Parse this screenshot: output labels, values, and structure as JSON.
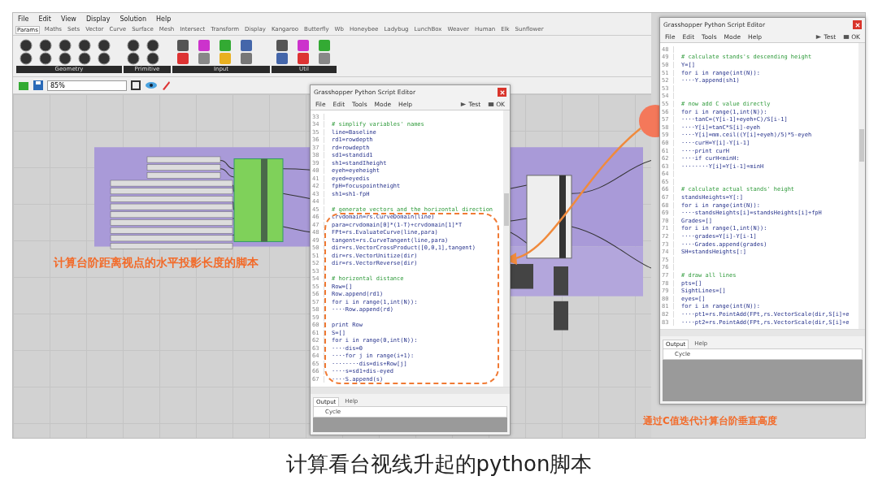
{
  "main_window": {
    "menu": [
      "File",
      "Edit",
      "View",
      "Display",
      "Solution",
      "Help"
    ],
    "tabs": [
      {
        "label": "Params",
        "selected": true
      },
      {
        "label": "Maths",
        "selected": false
      },
      {
        "label": "Sets",
        "selected": false
      },
      {
        "label": "Vector",
        "selected": false
      },
      {
        "label": "Curve",
        "selected": false
      },
      {
        "label": "Surface",
        "selected": false
      },
      {
        "label": "Mesh",
        "selected": false
      },
      {
        "label": "Intersect",
        "selected": false
      },
      {
        "label": "Transform",
        "selected": false
      },
      {
        "label": "Display",
        "selected": false
      },
      {
        "label": "Kangaroo",
        "selected": false
      },
      {
        "label": "Butterfly",
        "selected": false
      },
      {
        "label": "Wb",
        "selected": false
      },
      {
        "label": "Honeybee",
        "selected": false
      },
      {
        "label": "Ladybug",
        "selected": false
      },
      {
        "label": "LunchBox",
        "selected": false
      },
      {
        "label": "Weaver",
        "selected": false
      },
      {
        "label": "Human",
        "selected": false
      },
      {
        "label": "Elk",
        "selected": false
      },
      {
        "label": "Sunflower",
        "selected": false
      }
    ],
    "toolbar_groups": [
      "Geometry",
      "Primitive",
      "Input",
      "Util"
    ],
    "zoom": "85%"
  },
  "editors": [
    {
      "title": "Grasshopper Python Script Editor",
      "menu": [
        "File",
        "Edit",
        "Tools",
        "Mode",
        "Help"
      ],
      "test": "Test",
      "ok": "OK",
      "output_tabs": [
        {
          "label": "Output",
          "selected": true
        },
        {
          "label": "Help",
          "selected": false
        }
      ],
      "column": "Cycle",
      "lines": [
        {
          "n": "33",
          "kind": "blank"
        },
        {
          "n": "34",
          "text": "# simplify variables' names",
          "kind": "comment"
        },
        {
          "n": "35",
          "text": "line=Baseline",
          "kind": "code"
        },
        {
          "n": "36",
          "text": "rd1=rowdepth",
          "kind": "code"
        },
        {
          "n": "37",
          "text": "rd=rowdepth",
          "kind": "code"
        },
        {
          "n": "38",
          "text": "sd1=standid1",
          "kind": "code"
        },
        {
          "n": "39",
          "text": "sh1=standIheight",
          "kind": "code"
        },
        {
          "n": "40",
          "text": "eyeh=eyeheight",
          "kind": "code"
        },
        {
          "n": "41",
          "text": "eyed=eyedis",
          "kind": "code"
        },
        {
          "n": "42",
          "text": "fpH=focuspointheight",
          "kind": "code"
        },
        {
          "n": "43",
          "text": "sh1=sh1-fpH",
          "kind": "code"
        },
        {
          "n": "44",
          "kind": "blank"
        },
        {
          "n": "45",
          "text": "# generate vectors and the horizontal direction",
          "kind": "comment"
        },
        {
          "n": "46",
          "text": "crvdomain=rs.CurveDomain(line)",
          "kind": "code"
        },
        {
          "n": "47",
          "text": "para=crvdomain[0]*(1-T)+crvdomain[1]*T",
          "kind": "code"
        },
        {
          "n": "48",
          "text": "FPt=rs.EvaluateCurve(line,para)",
          "kind": "code"
        },
        {
          "n": "49",
          "text": "tangent=rs.CurveTangent(line,para)",
          "kind": "code"
        },
        {
          "n": "50",
          "text": "dir=rs.VectorCrossProduct([0,0,1],tangent)",
          "kind": "code"
        },
        {
          "n": "51",
          "text": "dir=rs.VectorUnitize(dir)",
          "kind": "code"
        },
        {
          "n": "52",
          "text": "dir=rs.VectorReverse(dir)",
          "kind": "code"
        },
        {
          "n": "53",
          "kind": "blank"
        },
        {
          "n": "54",
          "text": "# horizontal distance",
          "kind": "comment"
        },
        {
          "n": "55",
          "text": "Row=[]",
          "kind": "code"
        },
        {
          "n": "56",
          "text": "Row.append(rd1)",
          "kind": "code"
        },
        {
          "n": "57",
          "text": "for i in range(1,int(N)):",
          "kind": "code"
        },
        {
          "n": "58",
          "text": "····Row.append(rd)",
          "kind": "code"
        },
        {
          "n": "59",
          "kind": "blank"
        },
        {
          "n": "60",
          "text": "print Row",
          "kind": "code"
        },
        {
          "n": "61",
          "text": "S=[]",
          "kind": "code"
        },
        {
          "n": "62",
          "text": "for i in range(0,int(N)):",
          "kind": "code"
        },
        {
          "n": "63",
          "text": "····dis=0",
          "kind": "code"
        },
        {
          "n": "64",
          "text": "····for j in range(i+1):",
          "kind": "code"
        },
        {
          "n": "65",
          "text": "········dis=dis+Row[j]",
          "kind": "code"
        },
        {
          "n": "66",
          "text": "····s=sd1+dis-eyed",
          "kind": "code"
        },
        {
          "n": "67",
          "text": "····S.append(s)",
          "kind": "code"
        }
      ]
    },
    {
      "title": "Grasshopper Python Script Editor",
      "menu": [
        "File",
        "Edit",
        "Tools",
        "Mode",
        "Help"
      ],
      "test": "Test",
      "ok": "OK",
      "output_tabs": [
        {
          "label": "Output",
          "selected": true
        },
        {
          "label": "Help",
          "selected": false
        }
      ],
      "column": "Cycle",
      "lines": [
        {
          "n": "48",
          "kind": "blank"
        },
        {
          "n": "49",
          "text": "# calculate stands's descending height",
          "kind": "comment"
        },
        {
          "n": "50",
          "text": "Y=[]",
          "kind": "code"
        },
        {
          "n": "51",
          "text": "for i in range(int(N)):",
          "kind": "code"
        },
        {
          "n": "52",
          "text": "····Y.append(sh1)",
          "kind": "code"
        },
        {
          "n": "53",
          "kind": "blank"
        },
        {
          "n": "54",
          "kind": "blank"
        },
        {
          "n": "55",
          "text": "# now add C value directly",
          "kind": "comment"
        },
        {
          "n": "56",
          "text": "for i in range(1,int(N)):",
          "kind": "code"
        },
        {
          "n": "57",
          "text": "····tanC=(Y[i-1]+eyeh+C)/S[i-1]",
          "kind": "code"
        },
        {
          "n": "58",
          "text": "····Y[i]=tanC*S[i]-eyeh",
          "kind": "code"
        },
        {
          "n": "59",
          "text": "····Y[i]=mm.ceil((Y[i]+eyeh)/5)*5-eyeh",
          "kind": "code"
        },
        {
          "n": "60",
          "text": "····curH=Y[i]-Y[i-1]",
          "kind": "code"
        },
        {
          "n": "61",
          "text": "····print curH",
          "kind": "code"
        },
        {
          "n": "62",
          "text": "····if curH<minH:",
          "kind": "code"
        },
        {
          "n": "63",
          "text": "········Y[i]=Y[i-1]+minH",
          "kind": "code"
        },
        {
          "n": "64",
          "kind": "blank"
        },
        {
          "n": "65",
          "kind": "blank"
        },
        {
          "n": "66",
          "text": "# calculate actual stands' height",
          "kind": "comment"
        },
        {
          "n": "67",
          "text": "standsHeights=Y[:]",
          "kind": "code"
        },
        {
          "n": "68",
          "text": "for i in range(int(N)):",
          "kind": "code"
        },
        {
          "n": "69",
          "text": "····standsHeights[i]=standsHeights[i]+fpH",
          "kind": "code"
        },
        {
          "n": "70",
          "text": "Grades=[]",
          "kind": "code"
        },
        {
          "n": "71",
          "text": "for i in range(1,int(N)):",
          "kind": "code"
        },
        {
          "n": "72",
          "text": "····grades=Y[i]-Y[i-1]",
          "kind": "code"
        },
        {
          "n": "73",
          "text": "····Grades.append(grades)",
          "kind": "code"
        },
        {
          "n": "74",
          "text": "SH=standsHeights[:]",
          "kind": "code"
        },
        {
          "n": "75",
          "kind": "blank"
        },
        {
          "n": "76",
          "kind": "blank"
        },
        {
          "n": "77",
          "text": "# draw all lines",
          "kind": "comment"
        },
        {
          "n": "78",
          "text": "pts=[]",
          "kind": "code"
        },
        {
          "n": "79",
          "text": "SightLines=[]",
          "kind": "code"
        },
        {
          "n": "80",
          "text": "eyes=[]",
          "kind": "code"
        },
        {
          "n": "81",
          "text": "for i in range(int(N)):",
          "kind": "code"
        },
        {
          "n": "82",
          "text": "····pt1=rs.PointAdd(FPt,rs.VectorScale(dir,S[i]+e",
          "kind": "code"
        },
        {
          "n": "83",
          "text": "····pt2=rs.PointAdd(FPt,rs.VectorScale(dir,S[i]+e",
          "kind": "code"
        }
      ]
    }
  ],
  "annotations": [
    "计算台阶距离视点的水平投影长度的脚本",
    "通过C值迭代计算台阶垂直高度"
  ],
  "caption": "计算看台视线升起的python脚本"
}
